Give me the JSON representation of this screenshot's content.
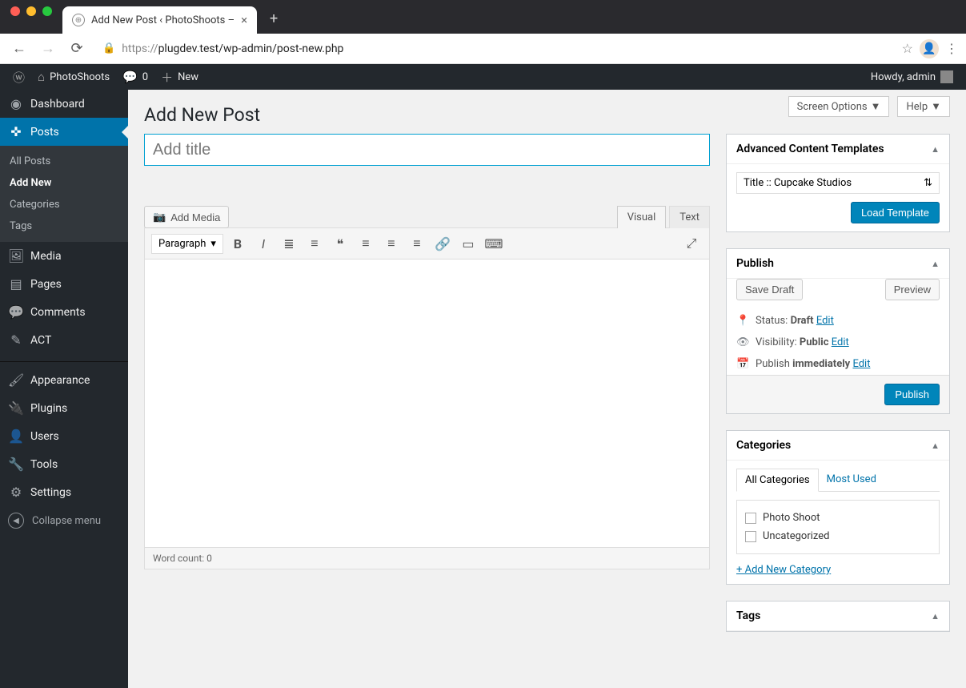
{
  "browser": {
    "tab_title": "Add New Post ‹ PhotoShoots –",
    "url_scheme": "https://",
    "url_path": "plugdev.test/wp-admin/post-new.php"
  },
  "adminbar": {
    "site_name": "PhotoShoots",
    "comment_count": "0",
    "new_label": "New",
    "howdy": "Howdy, admin"
  },
  "menu": {
    "items": [
      {
        "label": "Dashboard",
        "icon": "◉"
      },
      {
        "label": "Posts",
        "icon": "✜",
        "current": true,
        "sub": [
          {
            "label": "All Posts"
          },
          {
            "label": "Add New",
            "current": true
          },
          {
            "label": "Categories"
          },
          {
            "label": "Tags"
          }
        ]
      },
      {
        "label": "Media",
        "icon": "🖼"
      },
      {
        "label": "Pages",
        "icon": "▤"
      },
      {
        "label": "Comments",
        "icon": "💬"
      },
      {
        "label": "ACT",
        "icon": "✎"
      },
      {
        "sep": true
      },
      {
        "label": "Appearance",
        "icon": "🖌"
      },
      {
        "label": "Plugins",
        "icon": "🔌"
      },
      {
        "label": "Users",
        "icon": "👤"
      },
      {
        "label": "Tools",
        "icon": "🔧"
      },
      {
        "label": "Settings",
        "icon": "⚙"
      }
    ],
    "collapse_label": "Collapse menu"
  },
  "topButtons": {
    "screen_options": "Screen Options",
    "help": "Help"
  },
  "page": {
    "title": "Add New Post",
    "title_placeholder": "Add title"
  },
  "editor": {
    "add_media": "Add Media",
    "tabs": {
      "visual": "Visual",
      "text": "Text"
    },
    "format_select": "Paragraph",
    "word_count": "Word count: 0"
  },
  "act_box": {
    "title": "Advanced Content Templates",
    "selected": "Title :: Cupcake Studios",
    "button": "Load Template"
  },
  "publish": {
    "title": "Publish",
    "save_draft": "Save Draft",
    "preview": "Preview",
    "status_label": "Status:",
    "status_value": "Draft",
    "visibility_label": "Visibility:",
    "visibility_value": "Public",
    "schedule_label": "Publish",
    "schedule_value": "immediately",
    "edit": "Edit",
    "publish_btn": "Publish"
  },
  "categories": {
    "title": "Categories",
    "tab_all": "All Categories",
    "tab_most": "Most Used",
    "items": [
      "Photo Shoot",
      "Uncategorized"
    ],
    "add_new": "+ Add New Category"
  },
  "tags": {
    "title": "Tags"
  }
}
